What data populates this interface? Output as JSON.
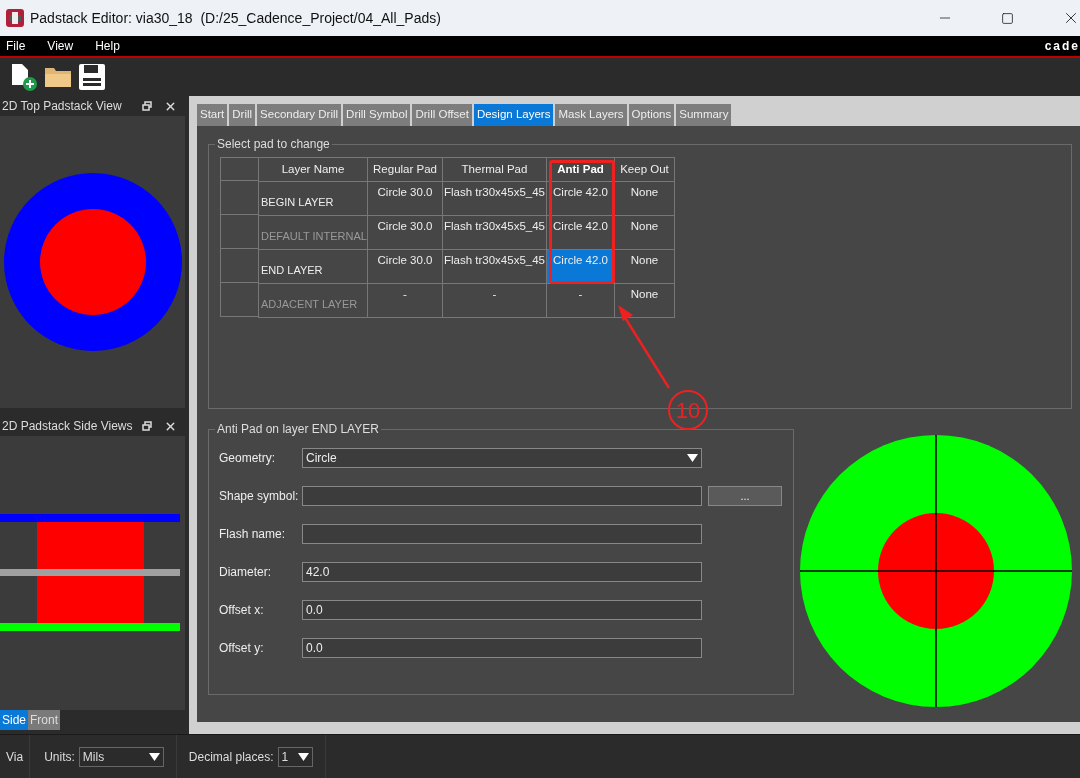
{
  "window": {
    "title": "Padstack Editor: via30_18  (D:/25_Cadence_Project/04_All_Pads)"
  },
  "menu": [
    "File",
    "View",
    "Help"
  ],
  "menu_bar_edge_text": "cade",
  "panels": [
    {
      "title": "2D Top Padstack View"
    },
    {
      "title": "2D Padstack Side Views"
    }
  ],
  "side_view_tabs": [
    {
      "label": "Side",
      "selected": true
    },
    {
      "label": "Front",
      "selected": false
    }
  ],
  "tabs": [
    {
      "label": "Start",
      "selected": false
    },
    {
      "label": "Drill",
      "selected": false
    },
    {
      "label": "Secondary Drill",
      "selected": false
    },
    {
      "label": "Drill Symbol",
      "selected": false
    },
    {
      "label": "Drill Offset",
      "selected": false
    },
    {
      "label": "Design Layers",
      "selected": true
    },
    {
      "label": "Mask Layers",
      "selected": false
    },
    {
      "label": "Options",
      "selected": false
    },
    {
      "label": "Summary",
      "selected": false
    }
  ],
  "pad_table": {
    "group_title": "Select pad to change",
    "columns": [
      {
        "label": "Layer Name",
        "selected": false
      },
      {
        "label": "Regular Pad",
        "selected": false
      },
      {
        "label": "Thermal Pad",
        "selected": false
      },
      {
        "label": "Anti Pad",
        "selected": true
      },
      {
        "label": "Keep Out",
        "selected": false
      }
    ],
    "rows": [
      {
        "cells": [
          {
            "text": "BEGIN LAYER",
            "enabled": true
          },
          {
            "text": "Circle 30.0",
            "selected": false
          },
          {
            "text": "Flash tr30x45x5_45",
            "selected": false
          },
          {
            "text": "Circle 42.0",
            "selected": false
          },
          {
            "text": "None",
            "selected": false
          }
        ]
      },
      {
        "cells": [
          {
            "text": "DEFAULT INTERNAL",
            "enabled": false
          },
          {
            "text": "Circle 30.0",
            "selected": false
          },
          {
            "text": "Flash tr30x45x5_45",
            "selected": false
          },
          {
            "text": "Circle 42.0",
            "selected": false
          },
          {
            "text": "None",
            "selected": false
          }
        ]
      },
      {
        "cells": [
          {
            "text": "END LAYER",
            "enabled": true
          },
          {
            "text": "Circle 30.0",
            "selected": false
          },
          {
            "text": "Flash tr30x45x5_45",
            "selected": false
          },
          {
            "text": "Circle 42.0",
            "selected": true
          },
          {
            "text": "None",
            "selected": false
          }
        ]
      },
      {
        "cells": [
          {
            "text": "ADJACENT LAYER",
            "enabled": false
          },
          {
            "text": "-",
            "selected": false
          },
          {
            "text": "-",
            "selected": false
          },
          {
            "text": "-",
            "selected": false
          },
          {
            "text": "None",
            "selected": false
          }
        ]
      }
    ]
  },
  "anti_pad": {
    "title": "Anti Pad on layer END LAYER",
    "fields": [
      {
        "kind": "dropdown",
        "label": "Geometry:",
        "value": "Circle"
      },
      {
        "kind": "browse",
        "label": "Shape symbol:",
        "button": "..."
      },
      {
        "kind": "text",
        "label": "Flash name:"
      },
      {
        "kind": "text",
        "label": "Diameter:",
        "value": "42.0"
      },
      {
        "kind": "text",
        "label": "Offset x:",
        "value": "0.0"
      },
      {
        "kind": "text",
        "label": "Offset y:",
        "value": "0.0"
      }
    ]
  },
  "annotation": {
    "label": "10"
  },
  "status_bar": {
    "mode": "Via",
    "units_label": "Units:",
    "units": "Mils",
    "decimal_label": "Decimal places:",
    "decimal": "1"
  }
}
